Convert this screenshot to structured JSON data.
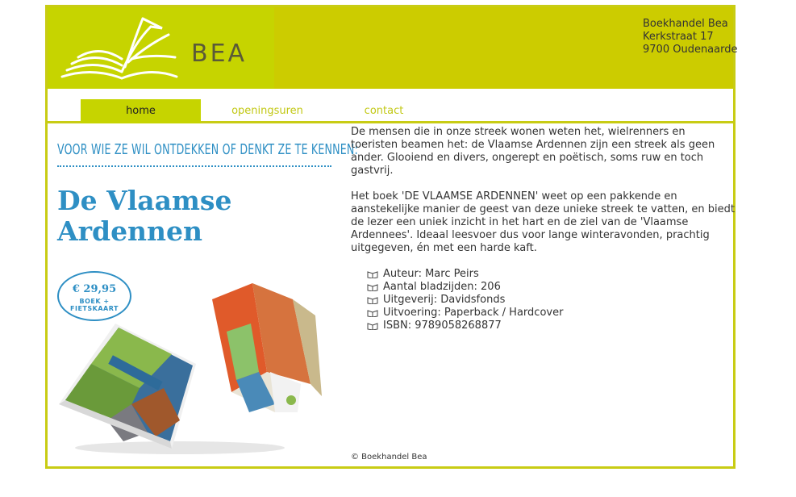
{
  "header": {
    "logo_text": "BEA",
    "address": [
      "Boekhandel Bea",
      "Kerkstraat 17",
      "9700 Oudenaarde"
    ]
  },
  "nav": {
    "items": [
      {
        "label": "home",
        "active": true
      },
      {
        "label": "openingsuren",
        "active": false
      },
      {
        "label": "contact",
        "active": false
      }
    ]
  },
  "promo": {
    "tagline": "VOOR WIE ZE WIL ONTDEKKEN OF DENKT ZE TE KENNEN:",
    "title_line1": "De Vlaamse",
    "title_line2": "Ardennen",
    "price": "€ 29,95",
    "price_sub": "BOEK + FIETSKAART"
  },
  "content": {
    "paragraph1": "De mensen die in onze streek wonen weten het, wielrenners en toeristen beamen het: de Vlaamse Ardennen zijn een streek als geen ander. Glooiend en divers, ongerept en poëtisch, soms ruw en toch gastvrij.",
    "paragraph2": "Het boek 'DE VLAAMSE ARDENNEN' weet op een pakkende en aanstekelijke manier de geest van deze unieke streek te vatten, en biedt de lezer een uniek inzicht in het hart en de ziel van de 'Vlaamse Ardennees'. Ideaal leesvoer dus voor lange winteravonden, prachtig uitgegeven, én met een harde kaft.",
    "details": [
      "Auteur: Marc Peirs",
      "Aantal bladzijden: 206",
      "Uitgeverij: Davidsfonds",
      "Uitvoering: Paperback / Hardcover",
      "ISBN: 9789058268877"
    ]
  },
  "footer": {
    "copyright": "© Boekhandel Bea"
  },
  "colors": {
    "accent": "#c6d400",
    "header_bg": "#cccc00",
    "promo_blue": "#2e8fc4"
  }
}
